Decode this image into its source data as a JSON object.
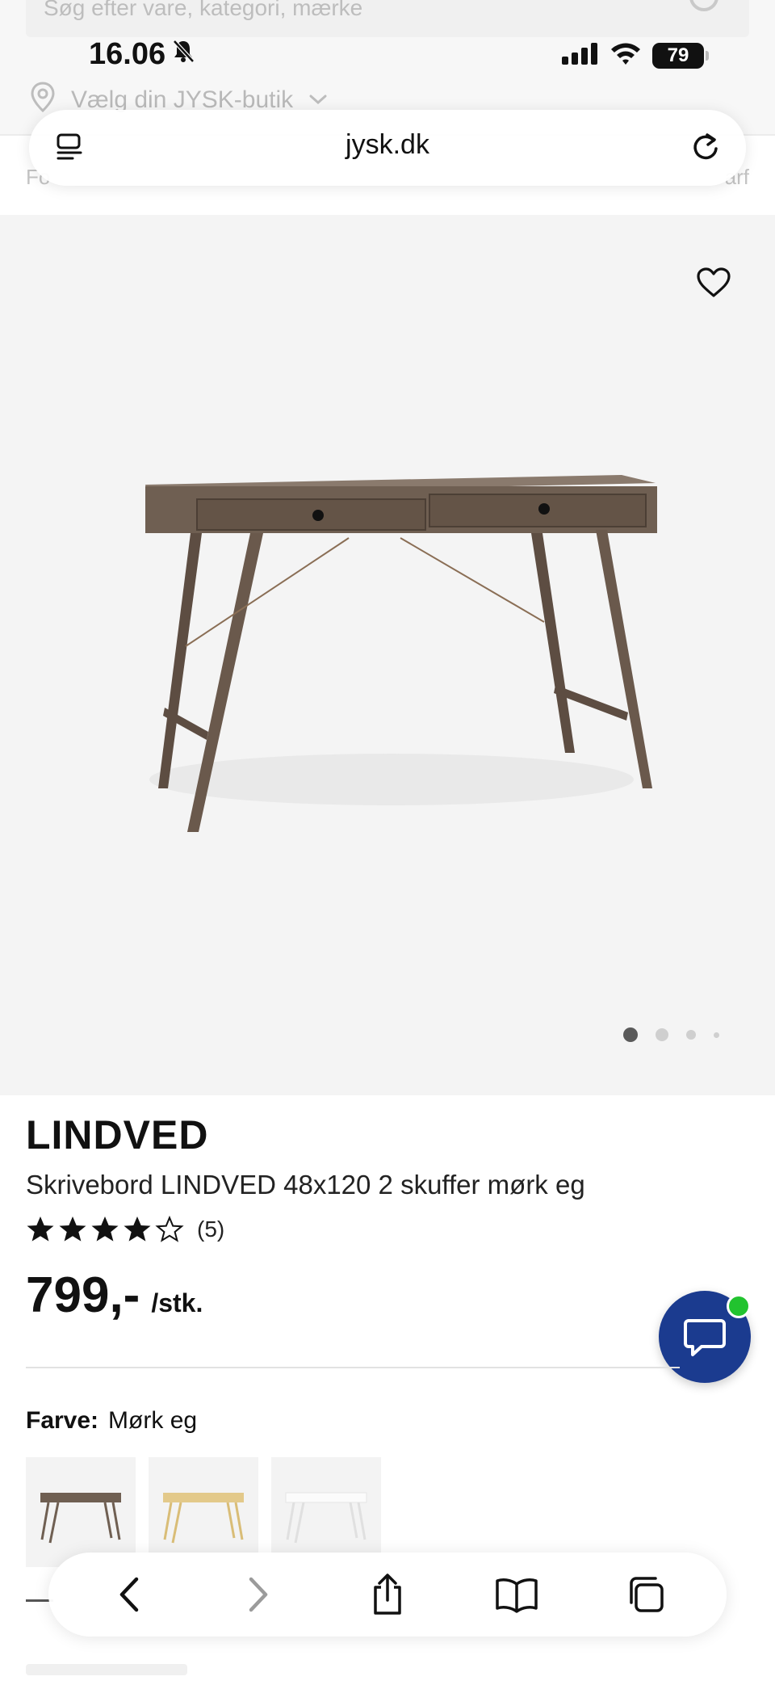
{
  "background_page": {
    "search_placeholder": "Søg efter vare, kategori, mærke",
    "store_selector": "Vælg din JYSK-butik",
    "nav_left_fragment": "Fo",
    "nav_right_fragment": "arf"
  },
  "status_bar": {
    "time": "16.06",
    "battery": "79"
  },
  "browser": {
    "url": "jysk.dk"
  },
  "product": {
    "brand": "LINDVED",
    "description": "Skrivebord LINDVED 48x120 2 skuffer mørk eg",
    "rating_stars": 4,
    "rating_max": 5,
    "rating_count": "(5)",
    "price": "799,-",
    "unit": "/stk.",
    "image_pages": 4,
    "active_image": 1,
    "colors": {
      "desk_wood": "#6f5f52",
      "desk_oak": "#e3c98a",
      "desk_white": "#f6f6f6"
    }
  },
  "variant": {
    "label": "Farve:",
    "value": "Mørk eg",
    "swatches": [
      "mørk eg",
      "eg",
      "hvid"
    ]
  },
  "chat": {
    "badge_color": "#22c32f",
    "button_color": "#1b3b8f"
  }
}
